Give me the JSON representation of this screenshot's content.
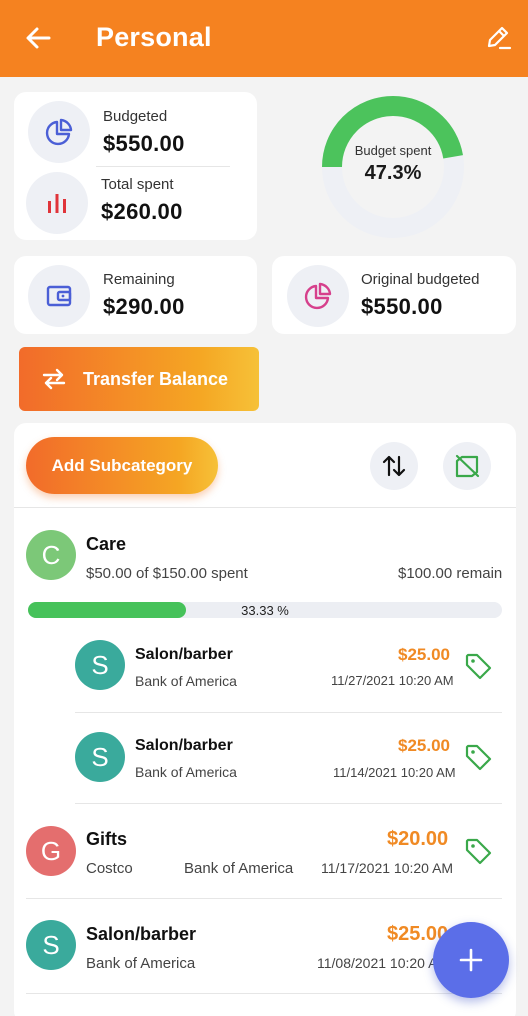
{
  "header": {
    "title": "Personal",
    "back_icon": "arrow-left-icon",
    "edit_icon": "pencil-icon",
    "color": "#f58220"
  },
  "summary": {
    "budgeted": {
      "label": "Budgeted",
      "value": "$550.00",
      "icon": "pie-chart-icon"
    },
    "total_spent": {
      "label": "Total spent",
      "value": "$260.00",
      "icon": "bar-chart-icon"
    },
    "remaining": {
      "label": "Remaining",
      "value": "$290.00",
      "icon": "wallet-icon"
    },
    "original_budgeted": {
      "label": "Original budgeted",
      "value": "$550.00",
      "icon": "pie-chart-icon"
    }
  },
  "donut": {
    "label": "Budget spent",
    "value_text": "47.3%",
    "fraction": 0.473,
    "color": "#4cc35c"
  },
  "actions": {
    "transfer_label": "Transfer Balance",
    "add_subcategory_label": "Add Subcategory",
    "sort_icon": "sort-icon",
    "hide_icon": "tag-off-icon"
  },
  "category": {
    "initial": "C",
    "name": "Care",
    "spent_text": "$50.00 of $150.00 spent",
    "remain_text": "$100.00 remain",
    "progress_fraction": 0.3333,
    "progress_text": "33.33 %",
    "transactions": [
      {
        "initial": "S",
        "name": "Salon/barber",
        "account": "Bank of America",
        "amount": "$25.00",
        "date": "11/27/2021 10:20 AM"
      },
      {
        "initial": "S",
        "name": "Salon/barber",
        "account": "Bank of America",
        "amount": "$25.00",
        "date": "11/14/2021 10:20 AM"
      }
    ]
  },
  "transactions": [
    {
      "initial": "G",
      "name": "Gifts",
      "payee": "Costco",
      "account": "Bank of America",
      "amount": "$20.00",
      "date": "11/17/2021 10:20 AM"
    },
    {
      "initial": "S",
      "name": "Salon/barber",
      "account": "Bank of America",
      "amount": "$25.00",
      "date": "11/08/2021 10:20 AM"
    }
  ],
  "fab": {
    "icon": "plus-icon"
  },
  "colors": {
    "accent": "#f58220",
    "teal": "#3aaa9c",
    "green_avatar": "#7cc878",
    "red_avatar": "#e46e6e",
    "fab": "#5b6ee8"
  }
}
